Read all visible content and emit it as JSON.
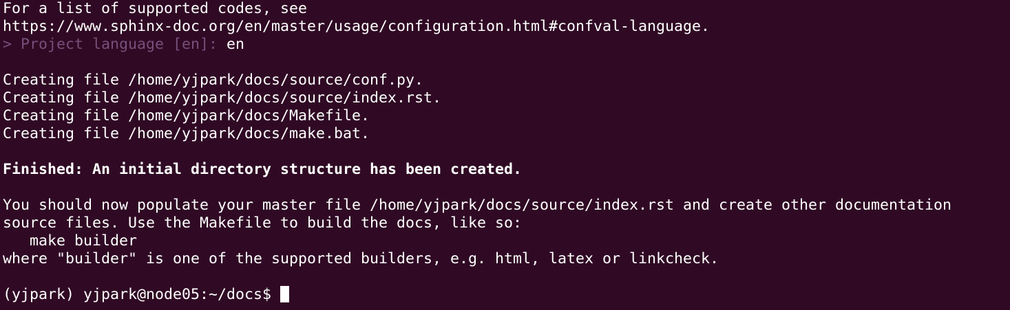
{
  "terminal": {
    "lines": {
      "l0": "For a list of supported codes, see",
      "l1": "https://www.sphinx-doc.org/en/master/usage/configuration.html#confval-language.",
      "l2_prompt": "> Project language [en]: ",
      "l2_answer": "en",
      "l4": "Creating file /home/yjpark/docs/source/conf.py.",
      "l5": "Creating file /home/yjpark/docs/source/index.rst.",
      "l6": "Creating file /home/yjpark/docs/Makefile.",
      "l7": "Creating file /home/yjpark/docs/make.bat.",
      "l9": "Finished: An initial directory structure has been created.",
      "l11": "You should now populate your master file /home/yjpark/docs/source/index.rst and create other documentation",
      "l12": "source files. Use the Makefile to build the docs, like so:",
      "l13": "   make builder",
      "l14": "where \"builder\" is one of the supported builders, e.g. html, latex or linkcheck.",
      "l16_prompt": "(yjpark) yjpark@node05:~/docs$ "
    },
    "colors": {
      "background": "#300a24",
      "foreground": "#ffffff",
      "prompt_question": "#75507b"
    }
  }
}
